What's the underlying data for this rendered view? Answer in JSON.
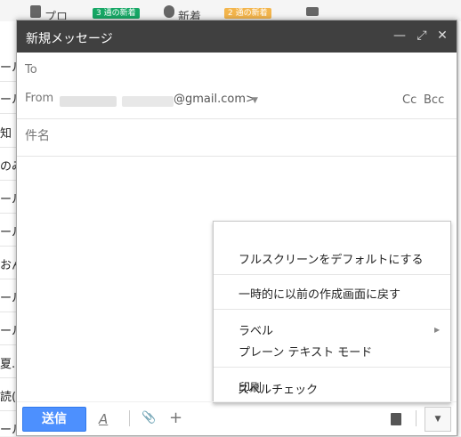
{
  "background": {
    "tabs": [
      {
        "label": "プロ",
        "badge": "3 通の新着",
        "badge_color": "#16a765"
      },
      {
        "label": "新着",
        "badge": "2 通の新着",
        "badge_color": "#f3b54c"
      }
    ],
    "list_fragments": [
      "ール",
      "ール",
      "知・",
      "のみ",
      "ール",
      "ール",
      "おん",
      "ール",
      "ール",
      "夏.",
      "読(",
      "ール"
    ]
  },
  "compose": {
    "title": "新規メッセージ",
    "controls": {
      "minimize": "—",
      "fullscreen": "⤢",
      "close": "✕"
    },
    "to_label": "To",
    "from_label": "From",
    "from_email_suffix": "@gmail.com>",
    "cc_label": "Cc",
    "bcc_label": "Bcc",
    "subject_placeholder": "件名"
  },
  "menu": {
    "items": [
      "フルスクリーンをデフォルトにする",
      "一時的に以前の作成画面に戻す",
      "ラベル",
      "プレーン テキスト モード",
      "印刷",
      "スペルチェック"
    ]
  },
  "toolbar": {
    "send_label": "送信",
    "format_icon": "A",
    "attach_icon": "📎",
    "insert_icon": "+",
    "more_icon": "▼"
  },
  "colors": {
    "title_bar": "#404040",
    "send_button": "#4d90fe"
  }
}
